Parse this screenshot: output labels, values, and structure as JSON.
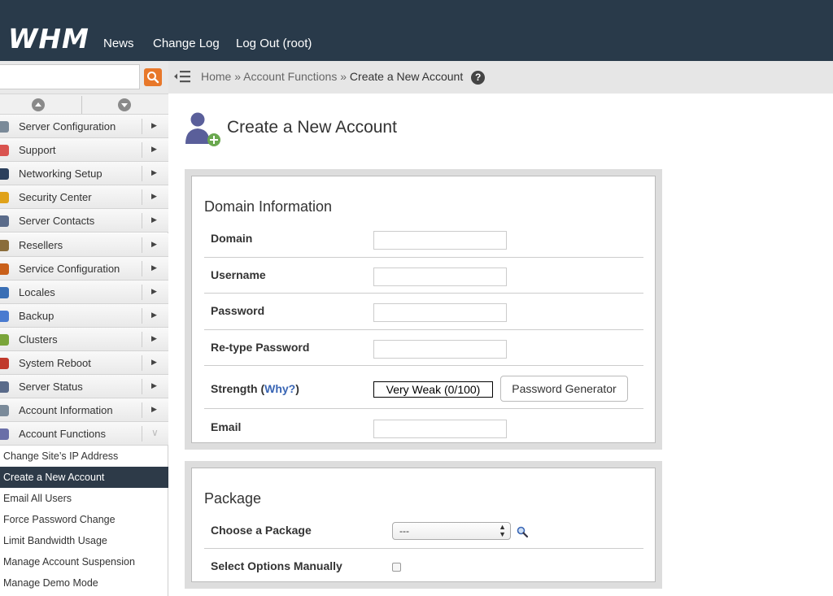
{
  "header": {
    "logo": "WHM",
    "nav": [
      "News",
      "Change Log",
      "Log Out (root)"
    ]
  },
  "sidebar": {
    "search": {
      "value": "",
      "placeholder": ""
    },
    "menu": [
      {
        "label": "Server Configuration",
        "icon": "server-config-icon",
        "color": "#7a8a99"
      },
      {
        "label": "Support",
        "icon": "lifebuoy-icon",
        "color": "#d9534f"
      },
      {
        "label": "Networking Setup",
        "icon": "network-globe-icon",
        "color": "#2b3f5c"
      },
      {
        "label": "Security Center",
        "icon": "lock-icon",
        "color": "#e0a21a"
      },
      {
        "label": "Server Contacts",
        "icon": "contacts-icon",
        "color": "#5a6b8a"
      },
      {
        "label": "Resellers",
        "icon": "resellers-icon",
        "color": "#8a6d3b"
      },
      {
        "label": "Service Configuration",
        "icon": "wrench-icon",
        "color": "#c9601a"
      },
      {
        "label": "Locales",
        "icon": "locales-icon",
        "color": "#3a6fb5"
      },
      {
        "label": "Backup",
        "icon": "backup-clock-icon",
        "color": "#4a7bd0"
      },
      {
        "label": "Clusters",
        "icon": "clusters-icon",
        "color": "#7aa53a"
      },
      {
        "label": "System Reboot",
        "icon": "power-icon",
        "color": "#c0392b"
      },
      {
        "label": "Server Status",
        "icon": "monitor-icon",
        "color": "#5a6b8a"
      },
      {
        "label": "Account Information",
        "icon": "account-info-icon",
        "color": "#7a8a99"
      },
      {
        "label": "Account Functions",
        "icon": "account-user-icon",
        "color": "#6a6fa8"
      }
    ],
    "submenu": [
      "Change Site’s IP Address",
      "Create a New Account",
      "Email All Users",
      "Force Password Change",
      "Limit Bandwidth Usage",
      "Manage Account Suspension",
      "Manage Demo Mode"
    ]
  },
  "breadcrumb": {
    "home": "Home",
    "sep": "»",
    "parent": "Account Functions",
    "current": "Create a New Account"
  },
  "page": {
    "title": "Create a New Account"
  },
  "domain_info": {
    "title": "Domain Information",
    "domain_label": "Domain",
    "domain_value": "",
    "username_label": "Username",
    "username_value": "",
    "password_label": "Password",
    "password_value": "",
    "retype_label": "Re-type Password",
    "retype_value": "",
    "strength_label": "Strength (",
    "why_link": "Why?",
    "strength_close": ")",
    "strength_value": "Very Weak (0/100)",
    "pwgen_button": "Password Generator",
    "email_label": "Email",
    "email_value": ""
  },
  "package": {
    "title": "Package",
    "choose_label": "Choose a Package",
    "choose_value": "---",
    "manual_label": "Select Options Manually",
    "manual_checked": false
  },
  "colors": {
    "topbar": "#293a4a",
    "accent_orange": "#e8782a",
    "active_item": "#2d3a48",
    "link": "#3a66b5"
  }
}
